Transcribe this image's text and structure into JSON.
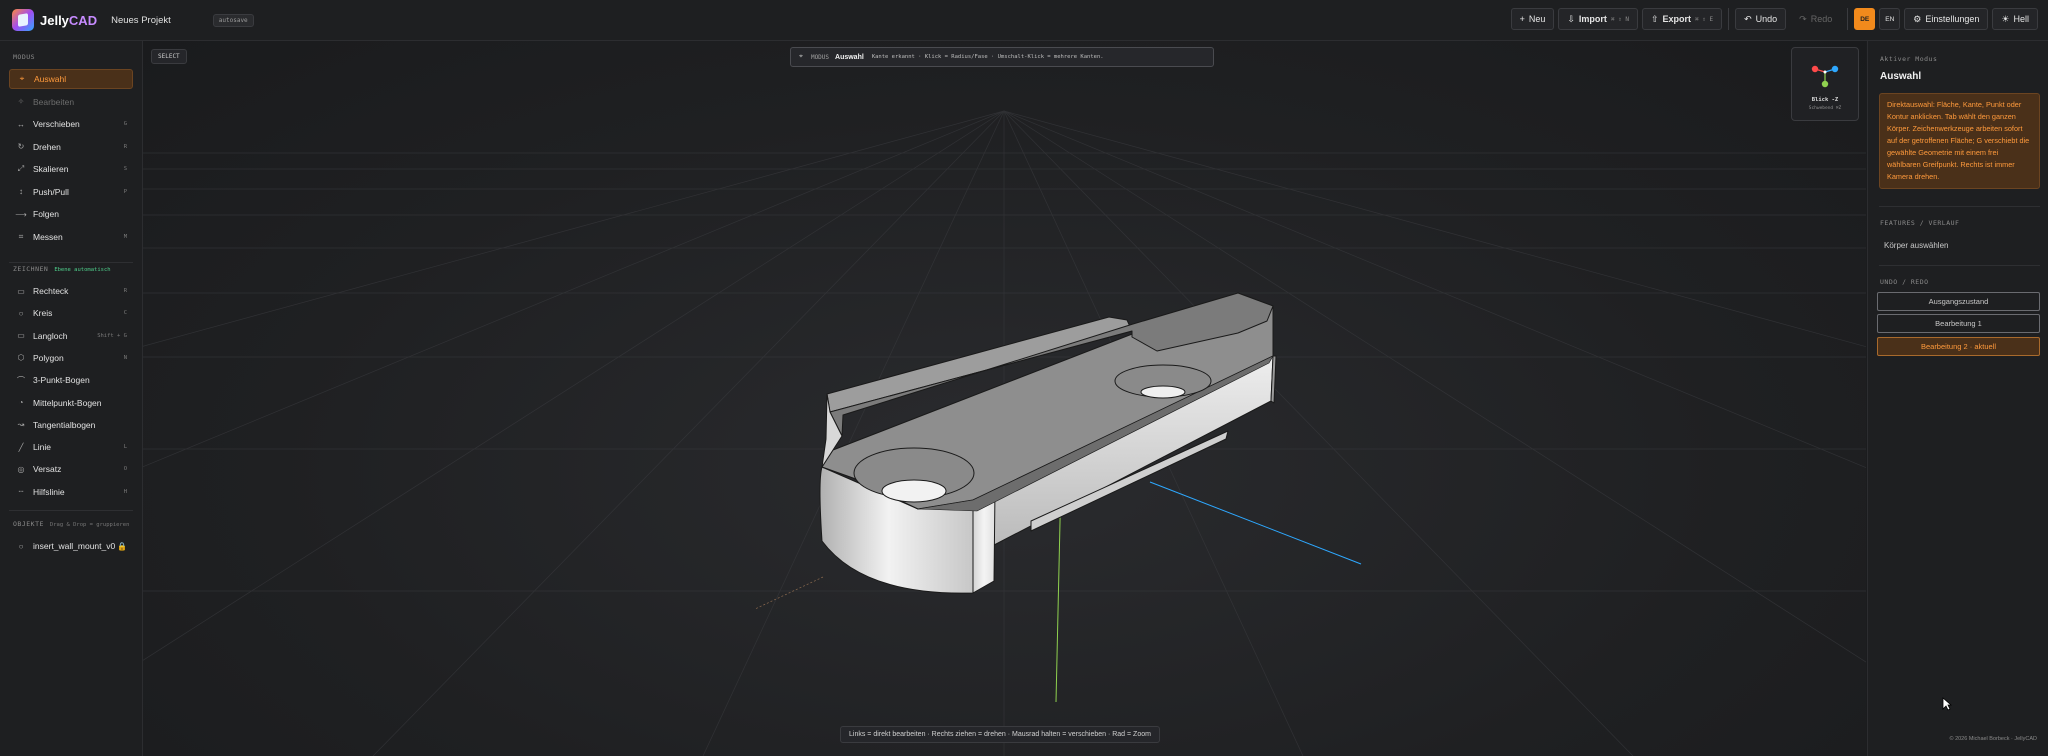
{
  "app": {
    "name_part1": "Jelly",
    "name_part2": "CAD",
    "project_name": "Neues Projekt",
    "autosave_label": "autosave"
  },
  "toolbar": {
    "new_label": "Neu",
    "import_label": "Import",
    "import_kbd": "⌘ ⇧ N",
    "export_label": "Export",
    "export_kbd": "⌘ ⇧ E",
    "undo_label": "Undo",
    "redo_label": "Redo",
    "lang_de": "DE",
    "lang_en": "EN",
    "settings_label": "Einstellungen",
    "theme_label": "Hell"
  },
  "sidebar": {
    "modes_title": "MODUS",
    "modes": [
      {
        "label": "Auswahl",
        "icon": "pointer-icon",
        "glyph": "⌖",
        "kbd": ""
      },
      {
        "label": "Bearbeiten",
        "icon": "edit-icon",
        "glyph": "✧",
        "kbd": ""
      },
      {
        "label": "Verschieben",
        "icon": "move-icon",
        "glyph": "↔",
        "kbd": "G"
      },
      {
        "label": "Drehen",
        "icon": "rotate-icon",
        "glyph": "↻",
        "kbd": "R"
      },
      {
        "label": "Skalieren",
        "icon": "scale-icon",
        "glyph": "⤢",
        "kbd": "S"
      },
      {
        "label": "Push/Pull",
        "icon": "push-pull-icon",
        "glyph": "↕",
        "kbd": "P"
      },
      {
        "label": "Folgen",
        "icon": "follow-icon",
        "glyph": "⟶",
        "kbd": ""
      },
      {
        "label": "Messen",
        "icon": "measure-icon",
        "glyph": "⌗",
        "kbd": "M"
      }
    ],
    "draw_title": "ZEICHNEN",
    "draw_hint": "Ebene automatisch",
    "draw_tools": [
      {
        "label": "Rechteck",
        "icon": "rectangle-icon",
        "glyph": "▭",
        "kbd": "R"
      },
      {
        "label": "Kreis",
        "icon": "circle-icon",
        "glyph": "○",
        "kbd": "C"
      },
      {
        "label": "Langloch",
        "icon": "slot-icon",
        "glyph": "▭",
        "kbd": "Shift + G"
      },
      {
        "label": "Polygon",
        "icon": "polygon-icon",
        "glyph": "⬡",
        "kbd": "N"
      },
      {
        "label": "3-Punkt-Bogen",
        "icon": "arc-3point-icon",
        "glyph": "⌒",
        "kbd": ""
      },
      {
        "label": "Mittelpunkt-Bogen",
        "icon": "arc-center-icon",
        "glyph": "◔",
        "kbd": ""
      },
      {
        "label": "Tangentialbogen",
        "icon": "arc-tangent-icon",
        "glyph": "↝",
        "kbd": ""
      },
      {
        "label": "Linie",
        "icon": "line-icon",
        "glyph": "╱",
        "kbd": "L"
      },
      {
        "label": "Versatz",
        "icon": "offset-icon",
        "glyph": "◎",
        "kbd": "O"
      },
      {
        "label": "Hilfslinie",
        "icon": "guide-line-icon",
        "glyph": "┄",
        "kbd": "H"
      }
    ],
    "objects_title": "OBJEKTE",
    "objects_hint": "Drag & Drop = gruppieren",
    "objects": [
      {
        "label": "insert_wall_mount_v0"
      }
    ]
  },
  "viewport": {
    "select_tag": "SELECT",
    "hint_mode": "MODUS",
    "hint_name": "Auswahl",
    "hint_text": "Kante erkannt · Klick = Radius/Fase · Umschalt-Klick = mehrere Kanten.",
    "viewcube_label": "Blick -Z",
    "viewcube_sub": "Schwebend ⌘Z",
    "status_text": "Links = direkt bearbeiten · Rechts ziehen = drehen · Mausrad halten = verschieben · Rad = Zoom"
  },
  "right_panel": {
    "active_mode_label": "Aktiver Modus",
    "active_mode": "Auswahl",
    "description": "Direktauswahl: Fläche, Kante, Punkt oder Kontur anklicken. Tab wählt den ganzen Körper. Zeichenwerkzeuge arbeiten sofort auf der getroffenen Fläche; G verschiebt die gewählte Geometrie mit einem frei wählbaren Greifpunkt. Rechts ist immer Kamera drehen.",
    "features_label": "FEATURES / VERLAUF",
    "features_empty": "Körper auswählen",
    "history_label": "UNDO / REDO",
    "history": [
      {
        "label": "Ausgangszustand",
        "current": false
      },
      {
        "label": "Bearbeitung 1",
        "current": false
      },
      {
        "label": "Bearbeitung 2 · aktuell",
        "current": true
      }
    ],
    "copyright": "© 2026 Michael Borbeck · JellyCAD"
  },
  "colors": {
    "accent": "#f28a1c",
    "accent_bg": "#4a3019",
    "axis_x": "#ff4a4a",
    "axis_y": "#8fd14f",
    "axis_z": "#2ea8ff",
    "background": "#1b1c1e"
  }
}
